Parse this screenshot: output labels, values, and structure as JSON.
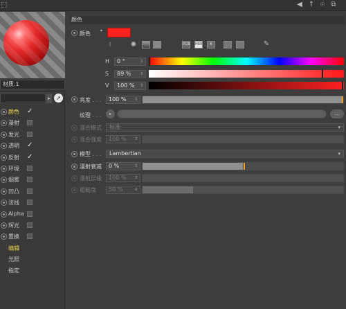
{
  "toolbar": {
    "icons": [
      "back-arrow-icon",
      "up-arrow-icon",
      "lock-icon",
      "new-window-icon"
    ],
    "icon_glyphs": [
      "◀",
      "↑",
      "🔒",
      "⧉"
    ]
  },
  "material": {
    "name": "材质.1"
  },
  "channels": [
    {
      "label": "颜色",
      "checked": true,
      "active": true
    },
    {
      "label": "漫射",
      "checked": false,
      "active": false
    },
    {
      "label": "发光",
      "checked": false,
      "active": false
    },
    {
      "label": "透明",
      "checked": true,
      "active": false
    },
    {
      "label": "反射",
      "checked": true,
      "active": false
    },
    {
      "label": "环境",
      "checked": false,
      "active": false
    },
    {
      "label": "烟雾",
      "checked": false,
      "active": false
    },
    {
      "label": "凹凸",
      "checked": false,
      "active": false
    },
    {
      "label": "法线",
      "checked": false,
      "active": false
    },
    {
      "label": "Alpha",
      "checked": false,
      "active": false
    },
    {
      "label": "辉光",
      "checked": false,
      "active": false
    },
    {
      "label": "置换",
      "checked": false,
      "active": false
    }
  ],
  "extra_items": [
    {
      "label": "编辑",
      "highlighted": true
    },
    {
      "label": "光照",
      "highlighted": false
    },
    {
      "label": "指定",
      "highlighted": false
    }
  ],
  "color_section": {
    "header": "颜色",
    "color_label": "颜色",
    "color_value": "#ff2020",
    "mode_buttons": [
      "RGB",
      "HSV",
      "K"
    ],
    "active_mode": "HSV",
    "h_label": "H",
    "h_value": "0 °",
    "s_label": "S",
    "s_value": "89 %",
    "v_label": "V",
    "v_value": "100 %",
    "brightness_label": "亮度",
    "brightness_value": "100 %",
    "brightness_fraction": 1.0,
    "texture_label": "纹理",
    "texture_dots": ". . .",
    "texture_more": "...",
    "mix_mode_label": "混合模式",
    "mix_mode_value": "标准",
    "mix_strength_label": "混合强度",
    "mix_strength_value": "100 %",
    "model_label": "模型",
    "model_value": "Lambertian",
    "diffuse_falloff_label": "漫射衰减",
    "diffuse_falloff_value": "0 %",
    "diffuse_level_label": "漫射层级",
    "diffuse_level_value": "100 %",
    "roughness_label": "粗糙度",
    "roughness_value": "50 %",
    "roughness_fraction": 0.25
  },
  "colors": {
    "accent": "#f0d24a",
    "swatch": "#ff2020",
    "marker": "#f0a020"
  }
}
